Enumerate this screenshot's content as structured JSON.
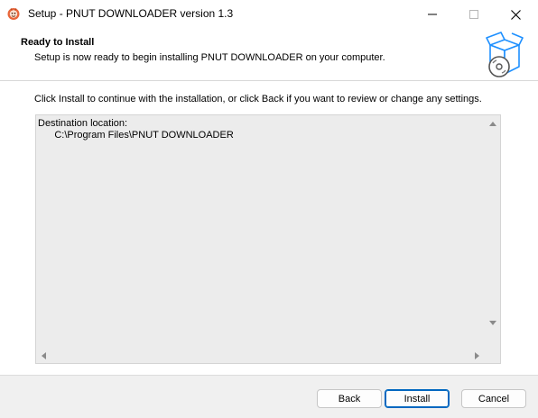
{
  "window": {
    "title": "Setup - PNUT DOWNLOADER version 1.3",
    "icon": "installer-app-icon",
    "controls": {
      "minimize": "minimize-icon",
      "maximize": "maximize-icon",
      "close": "close-icon"
    }
  },
  "header": {
    "title": "Ready to Install",
    "subtitle": "Setup is now ready to begin installing PNUT DOWNLOADER on your computer.",
    "art": "box-disc-icon"
  },
  "main": {
    "instruction": "Click Install to continue with the installation, or click Back if you want to review or change any settings.",
    "memo": {
      "heading": "Destination location:",
      "value": "      C:\\Program Files\\PNUT DOWNLOADER"
    }
  },
  "footer": {
    "back_label": "Back",
    "install_label": "Install",
    "cancel_label": "Cancel"
  },
  "colors": {
    "accent": "#0067c0",
    "background": "#f0f0f0",
    "panel": "#ffffff",
    "memo": "#ececec"
  }
}
